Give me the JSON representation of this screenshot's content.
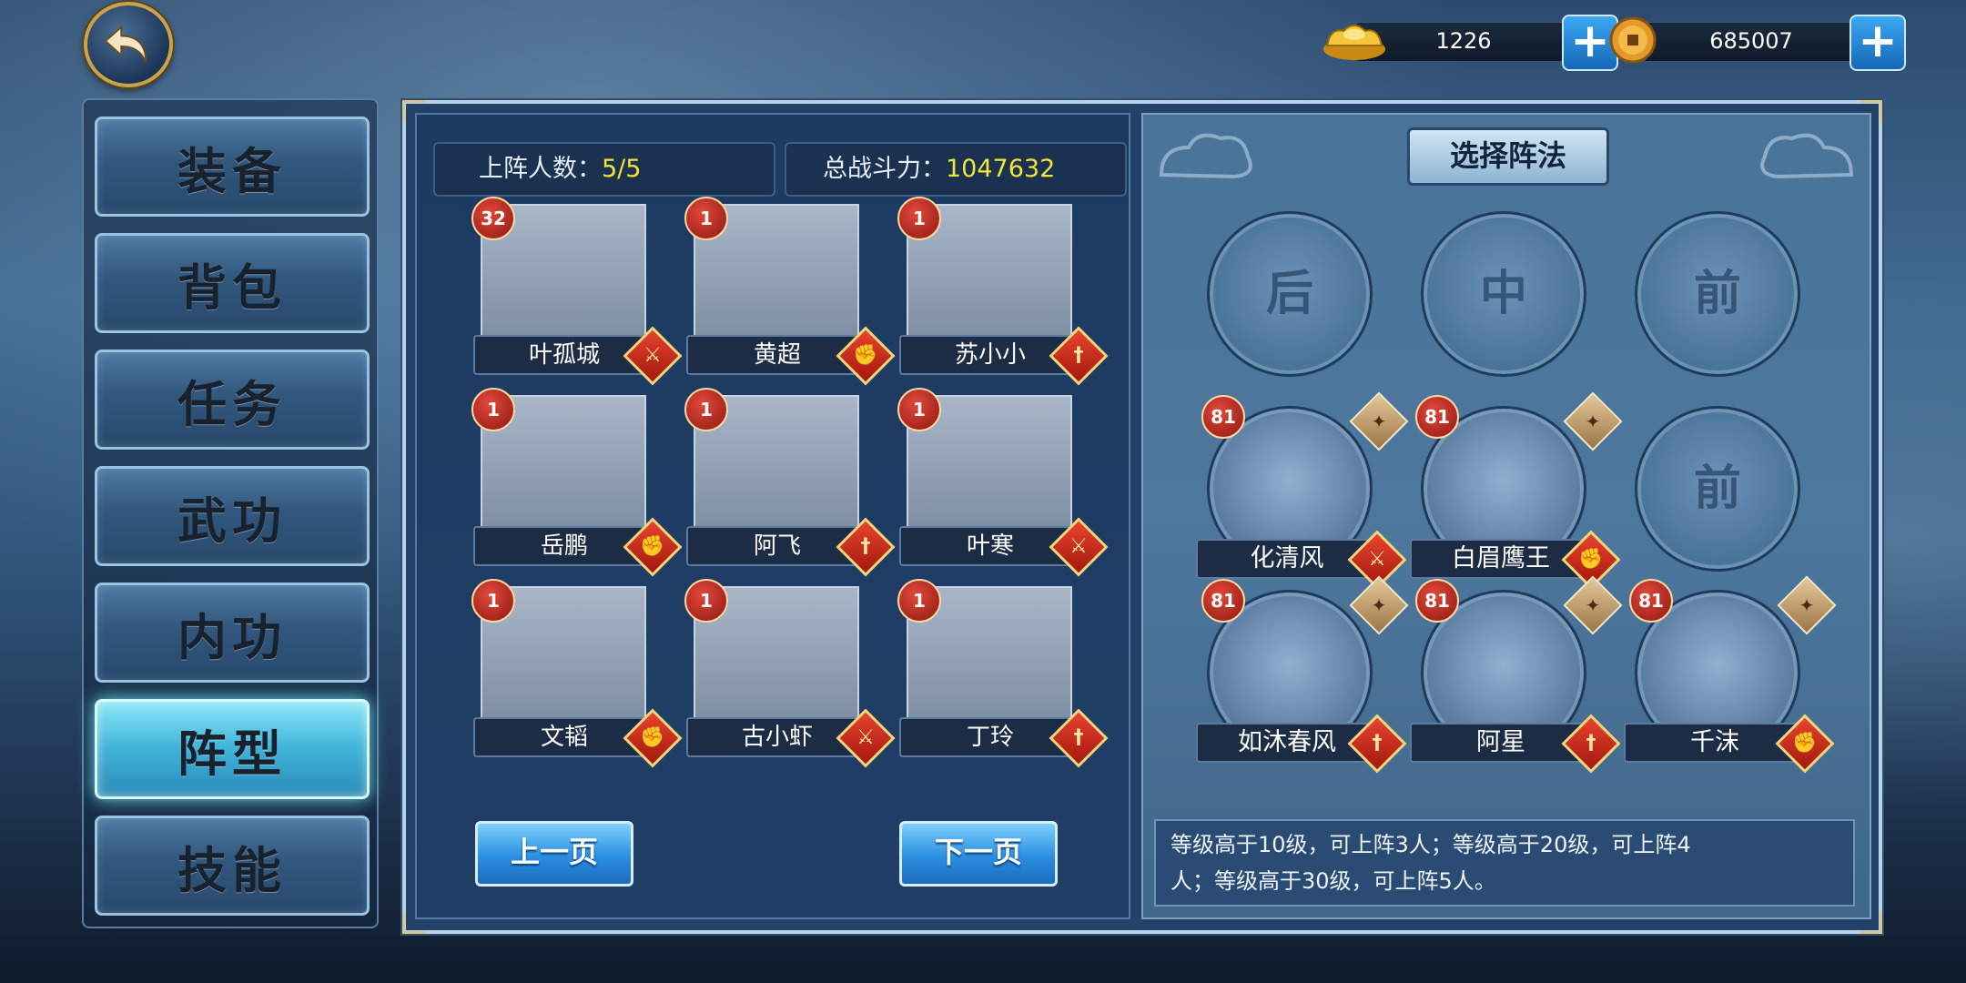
{
  "currency": {
    "gold": "1226",
    "coins": "685007"
  },
  "menu": {
    "items": [
      {
        "label": "装备",
        "active": false
      },
      {
        "label": "背包",
        "active": false
      },
      {
        "label": "任务",
        "active": false
      },
      {
        "label": "武功",
        "active": false
      },
      {
        "label": "内功",
        "active": false
      },
      {
        "label": "阵型",
        "active": true
      },
      {
        "label": "技能",
        "active": false
      }
    ]
  },
  "stats": {
    "deploy_label": "上阵人数：",
    "deploy_value": "5/5",
    "power_label": "总战斗力：",
    "power_value": "1047632"
  },
  "heroes": [
    {
      "name": "叶孤城",
      "level": "32",
      "type": "sword"
    },
    {
      "name": "黄超",
      "level": "1",
      "type": "fist"
    },
    {
      "name": "苏小小",
      "level": "1",
      "type": "blade"
    },
    {
      "name": "岳鹏",
      "level": "1",
      "type": "fist"
    },
    {
      "name": "阿飞",
      "level": "1",
      "type": "blade"
    },
    {
      "name": "叶寒",
      "level": "1",
      "type": "sword"
    },
    {
      "name": "文韬",
      "level": "1",
      "type": "fist"
    },
    {
      "name": "古小虾",
      "level": "1",
      "type": "sword"
    },
    {
      "name": "丁玲",
      "level": "1",
      "type": "blade"
    }
  ],
  "pager": {
    "prev": "上一页",
    "next": "下一页"
  },
  "formation": {
    "title": "选择阵法",
    "slot_labels": [
      "后",
      "中",
      "前",
      "前"
    ],
    "placed": [
      {
        "name": "化清风",
        "level": "81",
        "type": "sword"
      },
      {
        "name": "白眉鹰王",
        "level": "81",
        "type": "fist"
      },
      {
        "name": "如沐春风",
        "level": "81",
        "type": "blade"
      },
      {
        "name": "阿星",
        "level": "81",
        "type": "blade"
      },
      {
        "name": "千沫",
        "level": "81",
        "type": "fist"
      }
    ],
    "info_line1": "等级高于10级，可上阵3人；等级高于20级，可上阵4",
    "info_line2": "人；等级高于30级，可上阵5人。"
  },
  "icons": {
    "back": "back-arrow-icon",
    "gold": "gold-ingot-icon",
    "coin": "copper-coin-icon",
    "plus": "plus-icon",
    "sword": "sword-icon",
    "fist": "fist-icon",
    "blade": "blade-icon"
  }
}
